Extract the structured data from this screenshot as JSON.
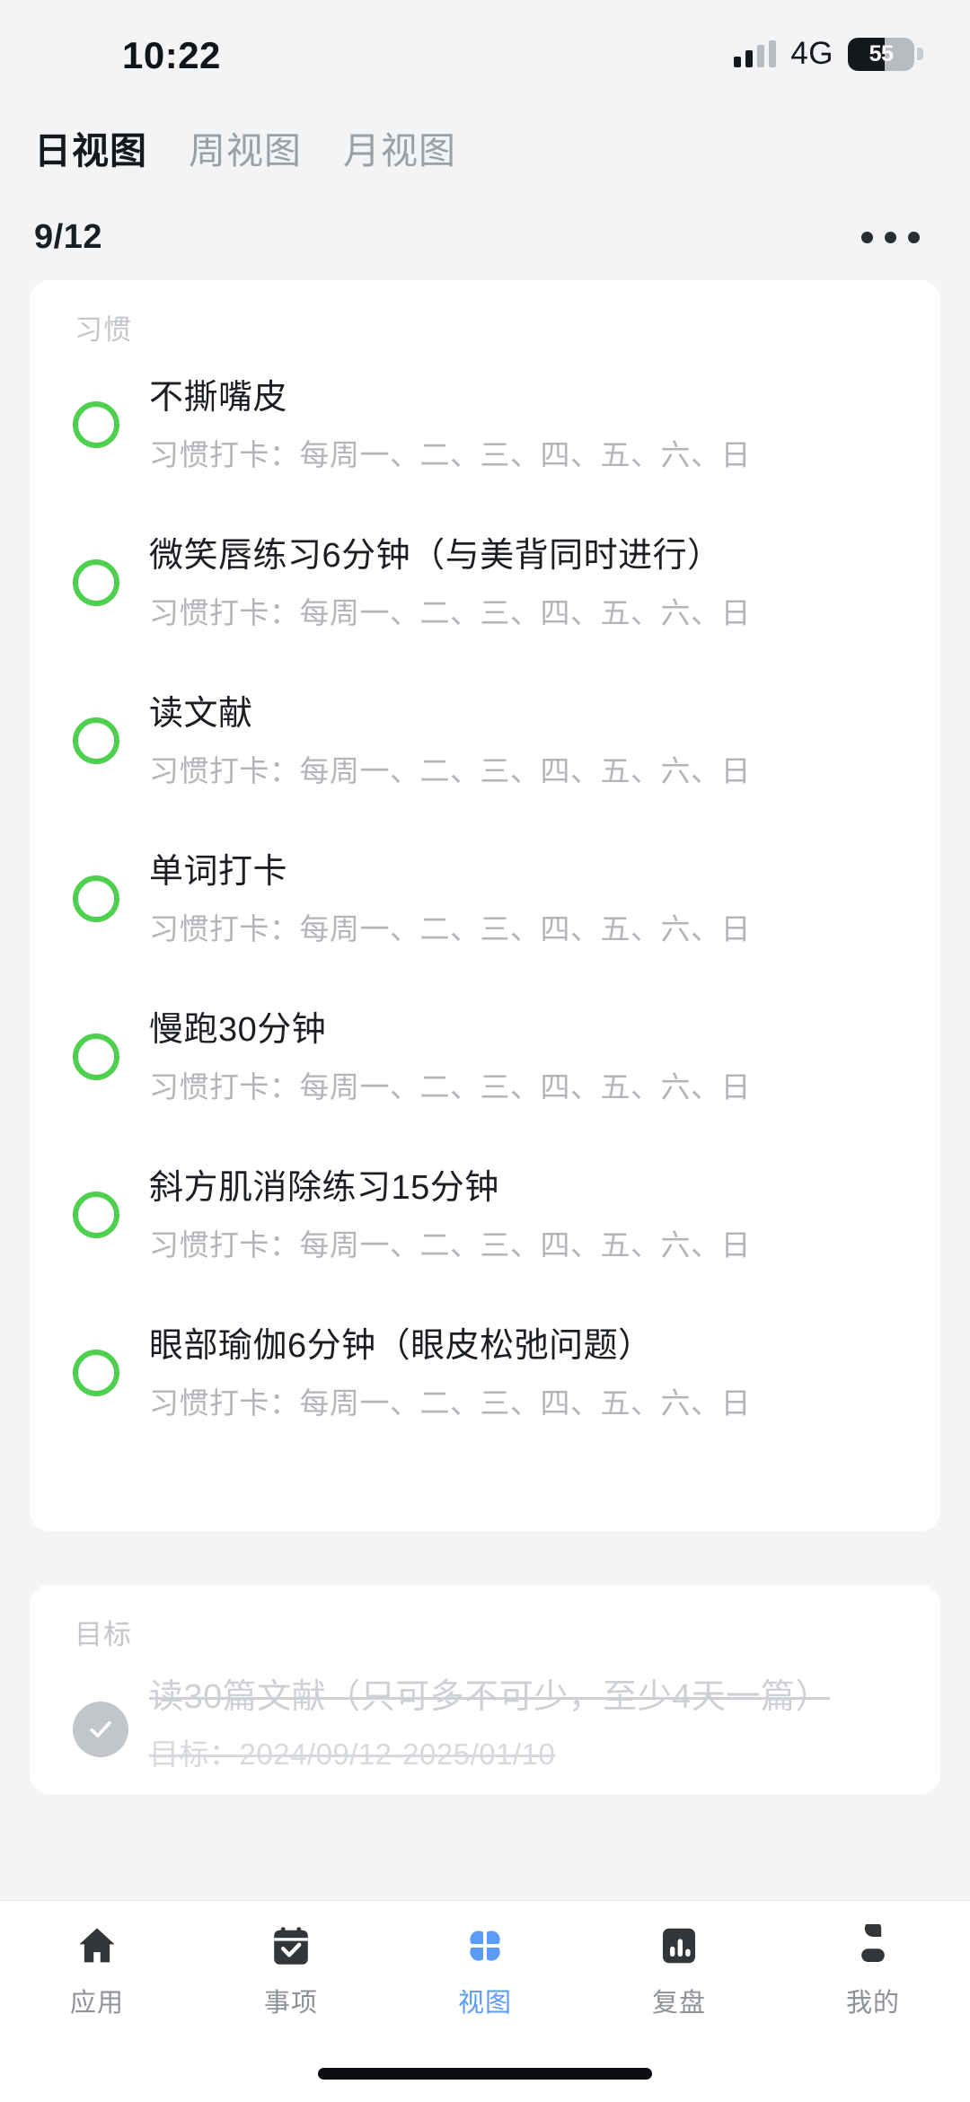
{
  "status_bar": {
    "time": "10:22",
    "network": "4G",
    "battery_percent": "55",
    "battery_level": 55,
    "signal_bars_filled": 2,
    "signal_bars_total": 4
  },
  "view_tabs": [
    {
      "label": "日视图",
      "active": true
    },
    {
      "label": "周视图",
      "active": false
    },
    {
      "label": "月视图",
      "active": false
    }
  ],
  "date_header": {
    "date": "9/12",
    "more_label": "•••"
  },
  "habit_card": {
    "section_title": "习惯",
    "items": [
      {
        "title": "不撕嘴皮",
        "subtitle": "习惯打卡：每周一、二、三、四、五、六、日",
        "done": false
      },
      {
        "title": "微笑唇练习6分钟（与美背同时进行）",
        "subtitle": "习惯打卡：每周一、二、三、四、五、六、日",
        "done": false
      },
      {
        "title": "读文献",
        "subtitle": "习惯打卡：每周一、二、三、四、五、六、日",
        "done": false
      },
      {
        "title": "单词打卡",
        "subtitle": "习惯打卡：每周一、二、三、四、五、六、日",
        "done": false
      },
      {
        "title": "慢跑30分钟",
        "subtitle": "习惯打卡：每周一、二、三、四、五、六、日",
        "done": false
      },
      {
        "title": "斜方肌消除练习15分钟",
        "subtitle": "习惯打卡：每周一、二、三、四、五、六、日",
        "done": false
      },
      {
        "title": "眼部瑜伽6分钟（眼皮松弛问题）",
        "subtitle": "习惯打卡：每周一、二、三、四、五、六、日",
        "done": false
      }
    ]
  },
  "goal_card": {
    "section_title": "目标",
    "items": [
      {
        "title": "读30篇文献（只可多不可少，至少4天一篇）",
        "subtitle": "目标：2024/09/12-2025/01/10",
        "done": true
      }
    ]
  },
  "tab_bar": [
    {
      "label": "应用",
      "icon": "home-icon",
      "active": false
    },
    {
      "label": "事项",
      "icon": "calendar-check-icon",
      "active": false
    },
    {
      "label": "视图",
      "icon": "four-petal-view-icon",
      "active": true
    },
    {
      "label": "复盘",
      "icon": "bar-chart-icon",
      "active": false
    },
    {
      "label": "我的",
      "icon": "person-icon",
      "active": false
    }
  ],
  "colors": {
    "page_background": "#f2f4f6",
    "card_background": "#ffffff",
    "habit_circle_green": "#4ed04e",
    "active_tab_blue": "#5b9cf8",
    "primary_text": "#1b1f24",
    "secondary_text": "#b2b6bb",
    "completed_text": "#cdd1d5"
  }
}
